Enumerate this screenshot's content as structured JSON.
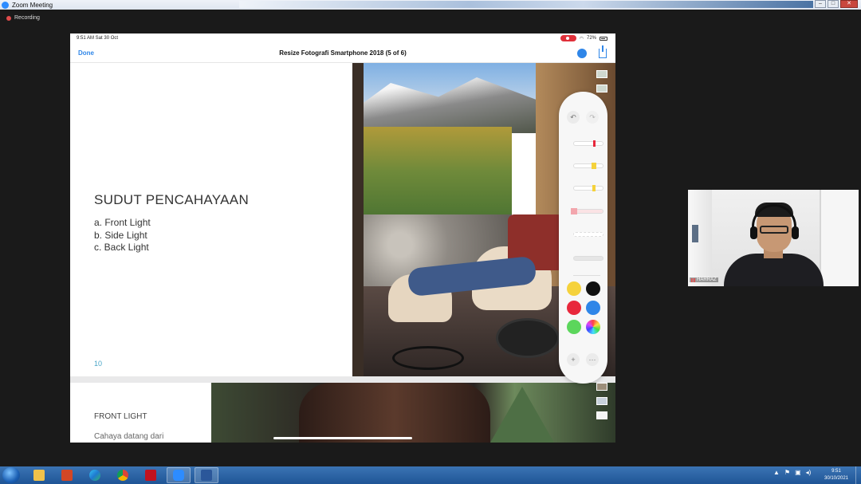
{
  "zoom": {
    "window_title": "Zoom Meeting",
    "recording_label": "Recording"
  },
  "ipad": {
    "status_time": "9:51 AM  Sat 30 Oct",
    "battery": "72%",
    "done_label": "Done",
    "doc_title": "Resize Fotografi Smartphone 2018 (5 of 6)"
  },
  "slide1": {
    "heading": "SUDUT PENCAHAYAAN",
    "bullets": [
      "a. Front Light",
      "b. Side Light",
      "c. Back Light"
    ],
    "page_number": "10"
  },
  "slide2": {
    "heading": "FRONT LIGHT",
    "text": "Cahaya datang dari"
  },
  "markup_toolbar": {
    "undo_icon": "↶",
    "redo_icon": "↷",
    "add_icon": "+",
    "more_icon": "···",
    "colors": [
      "#f5d23c",
      "#111111",
      "#e8283c",
      "#2f86e8",
      "#5cd65c"
    ],
    "tools": [
      "pen",
      "marker",
      "pencil",
      "eraser",
      "lasso",
      "ruler"
    ]
  },
  "participant": {
    "name": "HARRAZ"
  },
  "taskbar": {
    "apps": [
      "start",
      "file-explorer",
      "powerpoint",
      "edge",
      "chrome",
      "acrobat",
      "zoom",
      "word"
    ],
    "clock_time": "9:51",
    "clock_date": "30/10/2021"
  }
}
